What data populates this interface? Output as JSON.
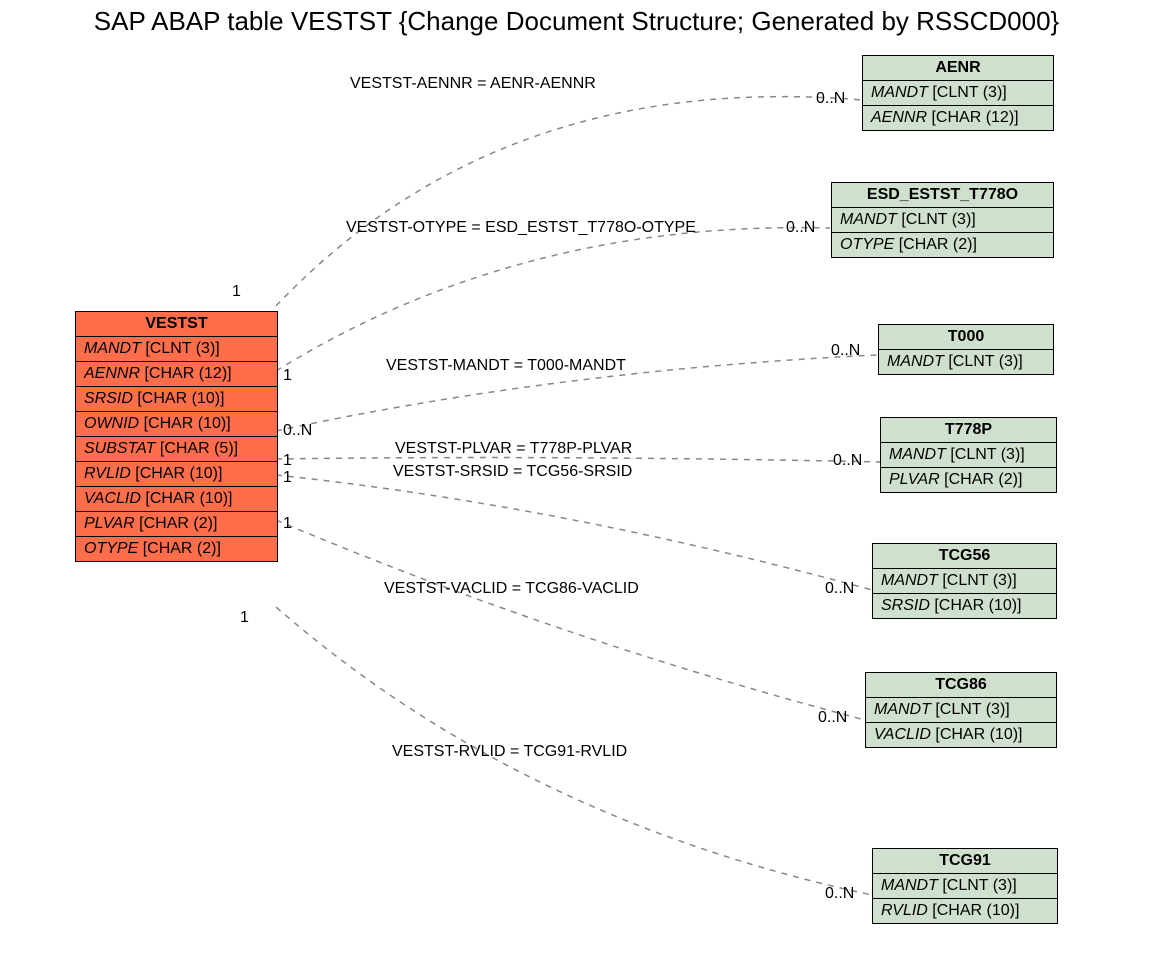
{
  "title": "SAP ABAP table VESTST {Change Document Structure; Generated by RSSCD000}",
  "main": {
    "name": "VESTST",
    "fields": [
      {
        "name": "MANDT",
        "type": "[CLNT (3)]"
      },
      {
        "name": "AENNR",
        "type": "[CHAR (12)]"
      },
      {
        "name": "SRSID",
        "type": "[CHAR (10)]"
      },
      {
        "name": "OWNID",
        "type": "[CHAR (10)]"
      },
      {
        "name": "SUBSTAT",
        "type": "[CHAR (5)]"
      },
      {
        "name": "RVLID",
        "type": "[CHAR (10)]"
      },
      {
        "name": "VACLID",
        "type": "[CHAR (10)]"
      },
      {
        "name": "PLVAR",
        "type": "[CHAR (2)]"
      },
      {
        "name": "OTYPE",
        "type": "[CHAR (2)]"
      }
    ]
  },
  "related": [
    {
      "name": "AENR",
      "fields": [
        {
          "name": "MANDT",
          "type": "[CLNT (3)]"
        },
        {
          "name": "AENNR",
          "type": "[CHAR (12)]"
        }
      ]
    },
    {
      "name": "ESD_ESTST_T778O",
      "fields": [
        {
          "name": "MANDT",
          "type": "[CLNT (3)]"
        },
        {
          "name": "OTYPE",
          "type": "[CHAR (2)]"
        }
      ]
    },
    {
      "name": "T000",
      "fields": [
        {
          "name": "MANDT",
          "type": "[CLNT (3)]"
        }
      ]
    },
    {
      "name": "T778P",
      "fields": [
        {
          "name": "MANDT",
          "type": "[CLNT (3)]"
        },
        {
          "name": "PLVAR",
          "type": "[CHAR (2)]"
        }
      ]
    },
    {
      "name": "TCG56",
      "fields": [
        {
          "name": "MANDT",
          "type": "[CLNT (3)]"
        },
        {
          "name": "SRSID",
          "type": "[CHAR (10)]"
        }
      ]
    },
    {
      "name": "TCG86",
      "fields": [
        {
          "name": "MANDT",
          "type": "[CLNT (3)]"
        },
        {
          "name": "VACLID",
          "type": "[CHAR (10)]"
        }
      ]
    },
    {
      "name": "TCG91",
      "fields": [
        {
          "name": "MANDT",
          "type": "[CLNT (3)]"
        },
        {
          "name": "RVLID",
          "type": "[CHAR (10)]"
        }
      ]
    }
  ],
  "edges": [
    {
      "label": "VESTST-AENNR = AENR-AENNR",
      "leftCard": "1",
      "rightCard": "0..N"
    },
    {
      "label": "VESTST-OTYPE = ESD_ESTST_T778O-OTYPE",
      "leftCard": "1",
      "rightCard": "0..N"
    },
    {
      "label": "VESTST-MANDT = T000-MANDT",
      "leftCard": "0..N",
      "rightCard": "0..N"
    },
    {
      "label": "VESTST-PLVAR = T778P-PLVAR",
      "leftCard": "1",
      "rightCard": "0..N"
    },
    {
      "label": "VESTST-SRSID = TCG56-SRSID",
      "leftCard": "1",
      "rightCard": "0..N"
    },
    {
      "label": "VESTST-VACLID = TCG86-VACLID",
      "leftCard": "1",
      "rightCard": "0..N"
    },
    {
      "label": "VESTST-RVLID = TCG91-RVLID",
      "leftCard": "1",
      "rightCard": "0..N"
    }
  ]
}
